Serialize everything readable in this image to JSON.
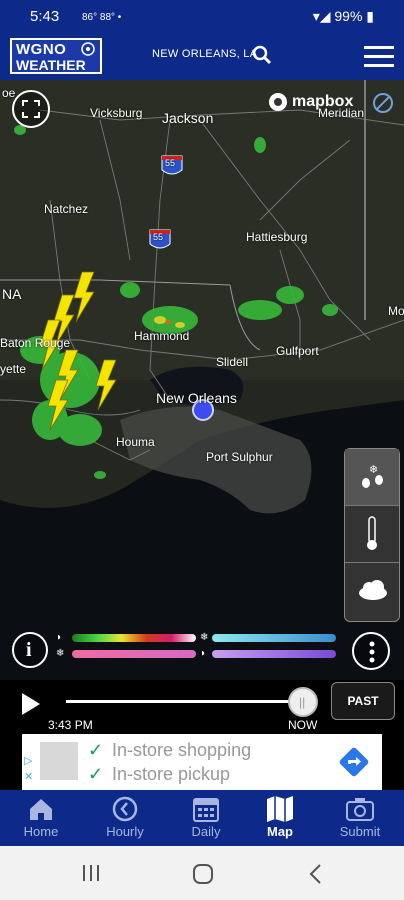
{
  "status_bar": {
    "time": "5:43",
    "temps": "86° 88° •",
    "battery": "99%"
  },
  "header": {
    "logo_line1": "WGNO",
    "logo_line2": "WEATHER",
    "location": "NEW ORLEANS, LA"
  },
  "map": {
    "attribution": "mapbox",
    "cities": [
      "Vicksburg",
      "Jackson",
      "Meridian",
      "Natchez",
      "Hattiesburg",
      "Mo",
      "NA",
      "Hammond",
      "Baton Rouge",
      "yette",
      "Slidell",
      "Gulfport",
      "New Orleans",
      "Houma",
      "Port Sulphur",
      "55",
      "55"
    ]
  },
  "timeline": {
    "start_time": "3:43 PM",
    "now_label": "NOW",
    "past_button": "PAST"
  },
  "ad": {
    "line1": "In-store shopping",
    "line2": "In-store pickup"
  },
  "nav": {
    "items": [
      {
        "label": "Home",
        "icon": "home-icon"
      },
      {
        "label": "Hourly",
        "icon": "clock-icon"
      },
      {
        "label": "Daily",
        "icon": "calendar-icon"
      },
      {
        "label": "Map",
        "icon": "map-icon",
        "active": true
      },
      {
        "label": "Submit",
        "icon": "camera-icon"
      }
    ]
  },
  "colors": {
    "header_bg": "#0d2a8a",
    "nav_inactive": "#a8b6e0",
    "lightning": "#f5e400",
    "location_dot": "#3b4cf0"
  }
}
